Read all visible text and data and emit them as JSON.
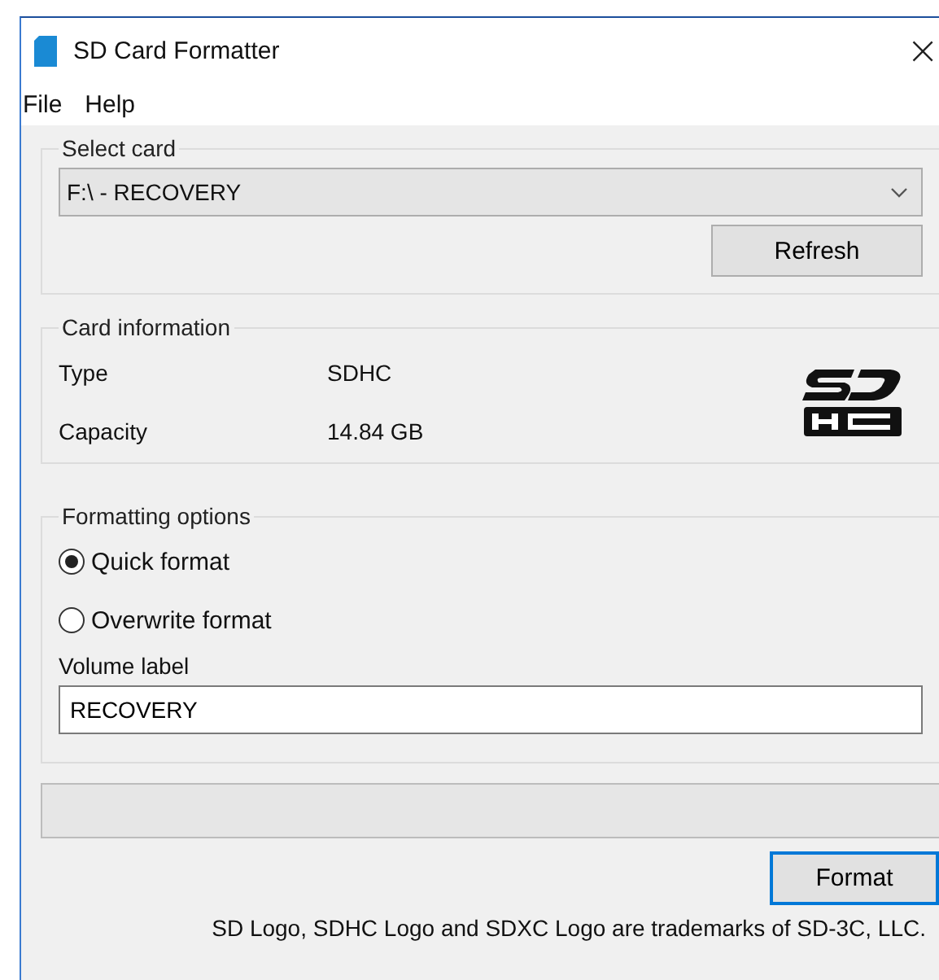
{
  "window": {
    "title": "SD Card Formatter",
    "close": "×"
  },
  "menu": [
    "File",
    "Help"
  ],
  "select_card": {
    "legend": "Select card",
    "dropdown": "F:\\ - RECOVERY",
    "refresh": "Refresh"
  },
  "card_information": {
    "legend": "Card information",
    "rows": [
      {
        "label": "Type",
        "value": "SDHC"
      },
      {
        "label": "Capacity",
        "value": "14.84 GB"
      }
    ]
  },
  "formatting_options": {
    "legend": "Formatting options",
    "options": [
      {
        "label": "Quick format",
        "selected": true
      },
      {
        "label": "Overwrite format",
        "selected": false
      }
    ],
    "volume_label": {
      "label": "Volume label",
      "value": "RECOVERY"
    }
  },
  "progress": {
    "level": 0
  },
  "format_button": "Format",
  "footer": "SD Logo, SDHC Logo and SDXC Logo are trademarks of SD-3C, LLC."
}
